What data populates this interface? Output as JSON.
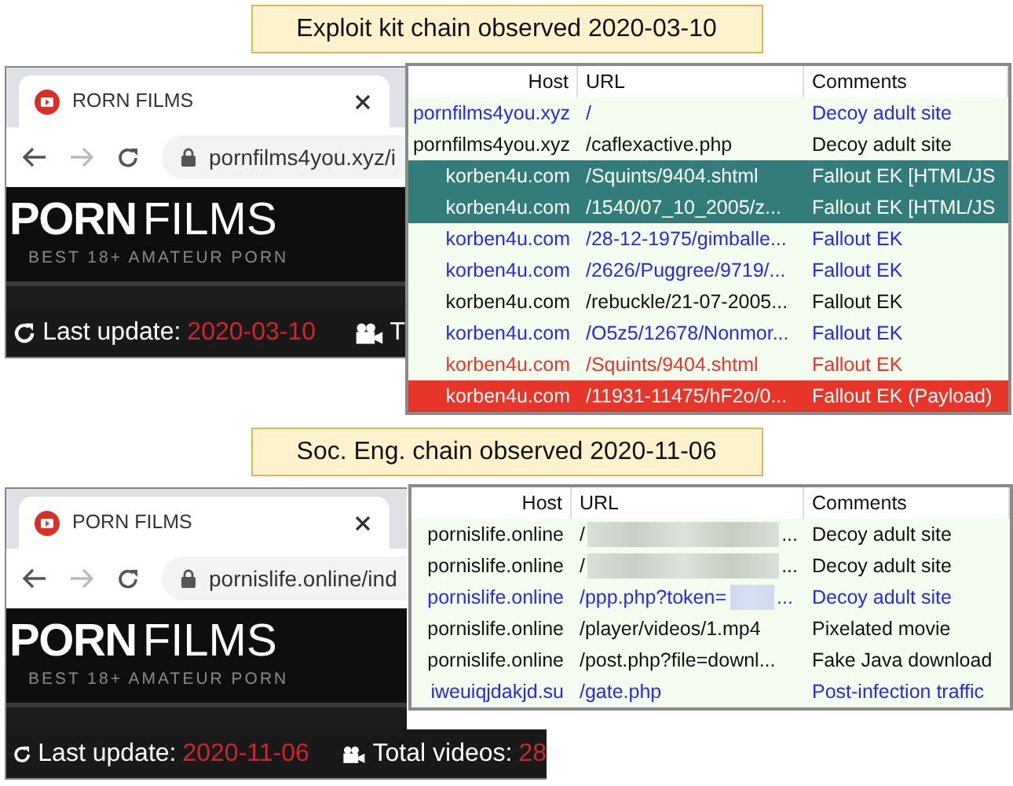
{
  "panels": [
    {
      "caption": "Exploit kit chain observed 2020-03-10",
      "browser": {
        "tab_title": "RORN FILMS",
        "url": "pornfilms4you.xyz/i",
        "logo_bold": "PORN",
        "logo_light": "FILMS",
        "tagline": "BEST 18+ AMATEUR PORN",
        "update_label": "Last update:",
        "update_date": "2020-03-10",
        "videos_label": "T"
      },
      "table": {
        "columns": [
          "Host",
          "URL",
          "Comments"
        ],
        "rows": [
          {
            "kind": "link",
            "host": "pornfilms4you.xyz",
            "url": "/",
            "comment": "Decoy adult site"
          },
          {
            "kind": "plain",
            "host": "pornfilms4you.xyz",
            "url": "/caflexactive.php",
            "comment": "Decoy adult site"
          },
          {
            "kind": "highlighted",
            "host": "korben4u.com",
            "url": "/Squints/9404.shtml",
            "comment": "Fallout EK [HTML/JS"
          },
          {
            "kind": "highlighted",
            "host": "korben4u.com",
            "url": "/1540/07_10_2005/z...",
            "comment": "Fallout EK [HTML/JS"
          },
          {
            "kind": "link",
            "host": "korben4u.com",
            "url": "/28-12-1975/gimballe...",
            "comment": "Fallout EK"
          },
          {
            "kind": "link",
            "host": "korben4u.com",
            "url": "/2626/Puggree/9719/...",
            "comment": "Fallout EK"
          },
          {
            "kind": "plain",
            "host": "korben4u.com",
            "url": "/rebuckle/21-07-2005...",
            "comment": "Fallout EK"
          },
          {
            "kind": "link",
            "host": "korben4u.com",
            "url": "/O5z5/12678/Nonmor...",
            "comment": "Fallout EK"
          },
          {
            "kind": "alert",
            "host": "korben4u.com",
            "url": "/Squints/9404.shtml",
            "comment": "Fallout EK"
          },
          {
            "kind": "payload",
            "host": "korben4u.com",
            "url": "/11931-11475/hF2o/0...",
            "comment": "Fallout EK (Payload)"
          }
        ]
      }
    },
    {
      "caption": "Soc. Eng. chain observed 2020-11-06",
      "browser": {
        "tab_title": "PORN FILMS",
        "url": "pornislife.online/ind",
        "logo_bold": "PORN",
        "logo_light": "FILMS",
        "tagline": "BEST 18+ AMATEUR PORN",
        "update_label": "Last update:",
        "update_date": "2020-11-06",
        "videos_label": "Total videos:",
        "videos_count": "28"
      },
      "table": {
        "columns": [
          "Host",
          "URL",
          "Comments"
        ],
        "rows": [
          {
            "kind": "plain",
            "host": "pornislife.online",
            "url": "/",
            "redacted": true,
            "url_end": "...",
            "comment": "Decoy adult site"
          },
          {
            "kind": "plain",
            "host": "pornislife.online",
            "url": "/",
            "redacted": true,
            "url_end": "...",
            "comment": "Decoy adult site"
          },
          {
            "kind": "link",
            "host": "pornislife.online",
            "url": "/ppp.php?token=",
            "redacted": true,
            "url_end": "...",
            "comment": "Decoy adult site"
          },
          {
            "kind": "plain",
            "host": "pornislife.online",
            "url": "/player/videos/1.mp4",
            "comment": "Pixelated movie"
          },
          {
            "kind": "plain",
            "host": "pornislife.online",
            "url": "/post.php?file=downl...",
            "comment": "Fake Java download"
          },
          {
            "kind": "link",
            "host": "iweuiqjdakjd.su",
            "url": "/gate.php",
            "comment": "Post-infection traffic"
          }
        ]
      }
    }
  ]
}
